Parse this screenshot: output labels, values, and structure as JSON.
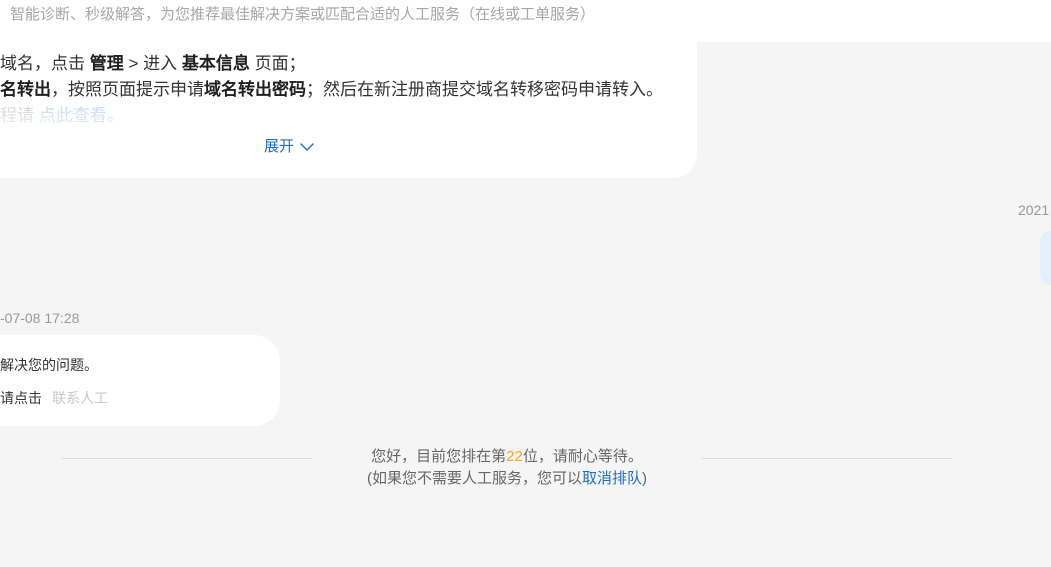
{
  "header": {
    "subtitle": "智能诊断、秒级解答，为您推荐最佳解决方案或匹配合适的人工服务（在线或工单服务）"
  },
  "answer_bubble": {
    "line1": [
      "域名，点击 ",
      "管理",
      " > 进入 ",
      "基本信息",
      " 页面；"
    ],
    "line2": [
      "名转出",
      "，按照页面提示申请",
      "域名转出密码",
      "；然后在新注册商提交域名转移密码申请转入。"
    ],
    "line3": [
      "程请 ",
      "点此查看",
      "。"
    ],
    "expand_label": "展开",
    "expand_icon": "chevron-down-icon"
  },
  "user_message": {
    "timestamp": "2021"
  },
  "bot_message": {
    "timestamp": "-07-08 17:28",
    "line1": "解决您的问题。",
    "prompt": "请点击",
    "contact_link": "联系人工"
  },
  "queue_notice": {
    "line1": [
      "您好，目前您排在第",
      "22",
      "位，请耐心等待。"
    ],
    "line2": [
      "(如果您不需要人工服务，您可以",
      "取消排队",
      ")"
    ]
  },
  "colors": {
    "page_background": "#f5f5f5",
    "bubble_background": "#ffffff",
    "user_bubble_background": "#e3effb",
    "text_primary": "#333333",
    "text_muted": "#999999",
    "link_blue": "#1e6fc7",
    "queue_position_orange": "#f5a623",
    "disabled_link": "#c8c8c8"
  }
}
